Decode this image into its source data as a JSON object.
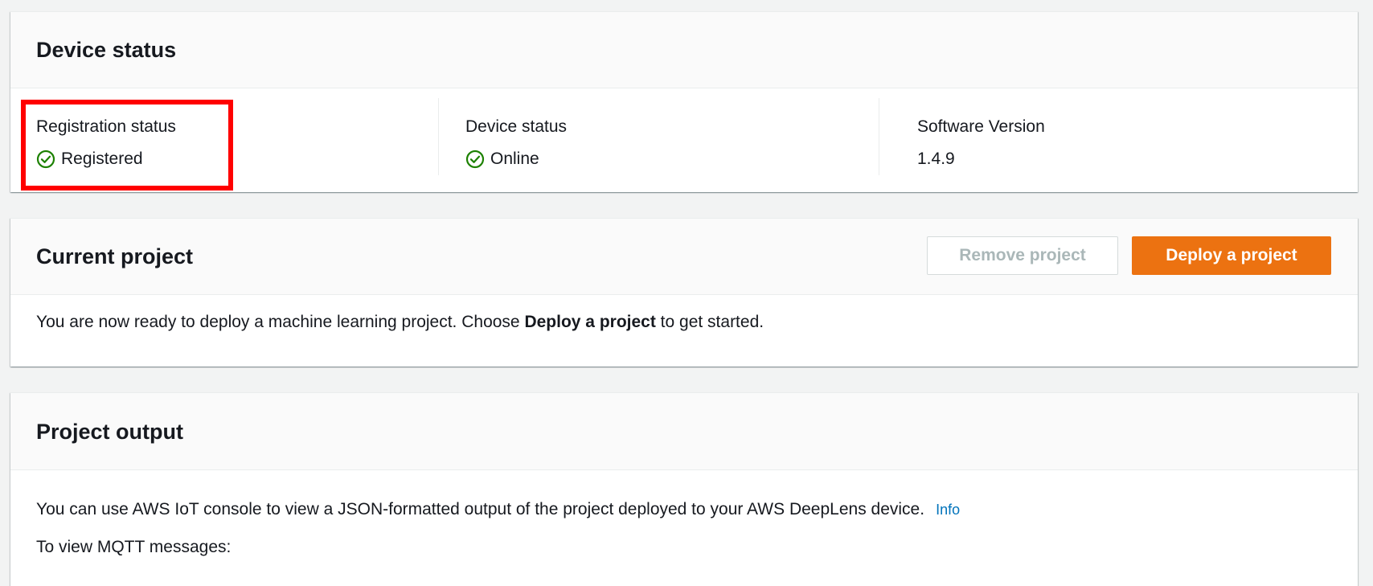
{
  "device_status_panel": {
    "title": "Device status",
    "columns": [
      {
        "label": "Registration status",
        "value": "Registered",
        "icon": "check-circle-icon"
      },
      {
        "label": "Device status",
        "value": "Online",
        "icon": "check-circle-icon"
      },
      {
        "label": "Software Version",
        "value": "1.4.9"
      }
    ]
  },
  "current_project_panel": {
    "title": "Current project",
    "remove_button": "Remove project",
    "deploy_button": "Deploy a project",
    "message_before": "You are now ready to deploy a machine learning project. Choose ",
    "message_bold": "Deploy a project",
    "message_after": " to get started."
  },
  "project_output_panel": {
    "title": "Project output",
    "description": "You can use AWS IoT console to view a JSON-formatted output of the project deployed to your AWS DeepLens device.",
    "info_link": "Info",
    "mqtt_text": "To view MQTT messages:"
  },
  "colors": {
    "success_green": "#1d8102",
    "primary_orange": "#ec7211",
    "link_blue": "#0073bb",
    "highlight_red": "#ff0000"
  }
}
